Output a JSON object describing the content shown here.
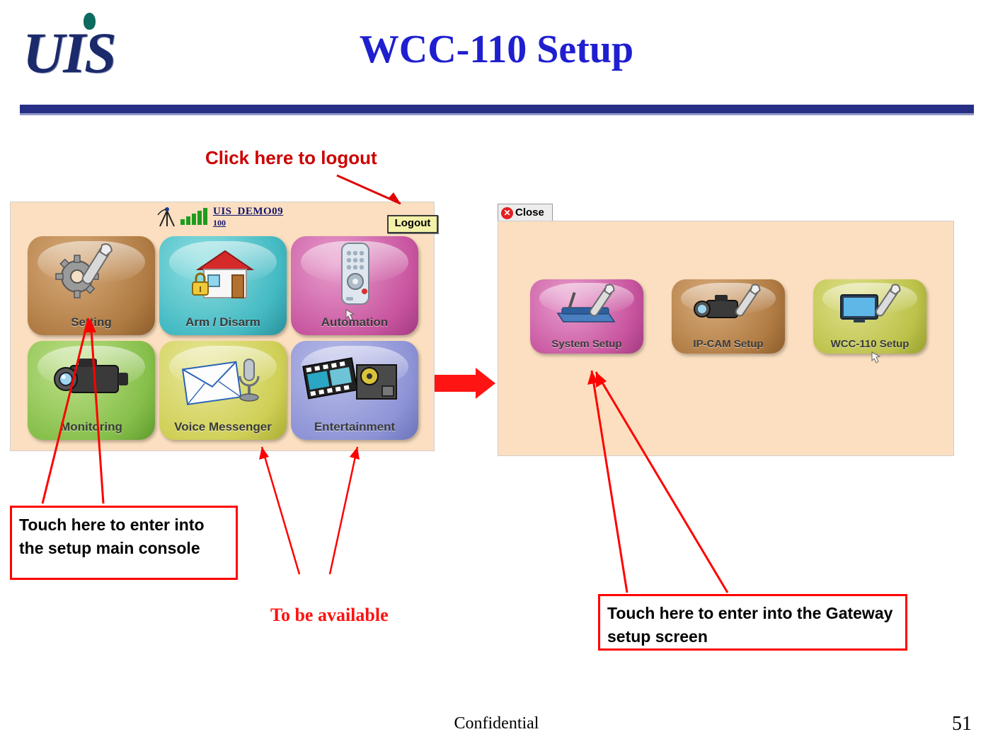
{
  "header": {
    "logo_text": "UIS",
    "title": "WCC-110 Setup"
  },
  "annotations": {
    "logout": "Click here to logout",
    "setup_console": "Touch here to enter into the setup main console",
    "to_be_available": "To be available",
    "gateway_setup": "Touch here to enter into the Gateway setup screen"
  },
  "left_screen": {
    "device_name": "UIS_DEMO09",
    "device_number": "100",
    "logout_label": "Logout",
    "signal_icon": "antenna-signal-icon",
    "tiles": [
      {
        "label": "Setting",
        "icon": "gear-wrench-icon",
        "color": "#b07b43"
      },
      {
        "label": "Arm / Disarm",
        "icon": "house-lock-icon",
        "color": "#43b9c2"
      },
      {
        "label": "Automation",
        "icon": "remote-control-icon",
        "color": "#c8559f"
      },
      {
        "label": "Monitoring",
        "icon": "video-camera-icon",
        "color": "#86bf4a"
      },
      {
        "label": "Voice Messenger",
        "icon": "envelope-microphone-icon",
        "color": "#cfcf56"
      },
      {
        "label": "Entertainment",
        "icon": "film-projector-icon",
        "color": "#8d93d6"
      }
    ]
  },
  "right_screen": {
    "close_label": "Close",
    "close_icon": "close-circle-icon",
    "tiles": [
      {
        "label": "System Setup",
        "icon": "router-wrench-icon",
        "color": "#c8559f"
      },
      {
        "label": "IP-CAM Setup",
        "icon": "camera-wrench-icon",
        "color": "#b07b43"
      },
      {
        "label": "WCC-110 Setup",
        "icon": "monitor-wrench-icon",
        "color": "#bcc24a"
      }
    ]
  },
  "footer": {
    "confidential": "Confidential",
    "page_number": "51"
  }
}
